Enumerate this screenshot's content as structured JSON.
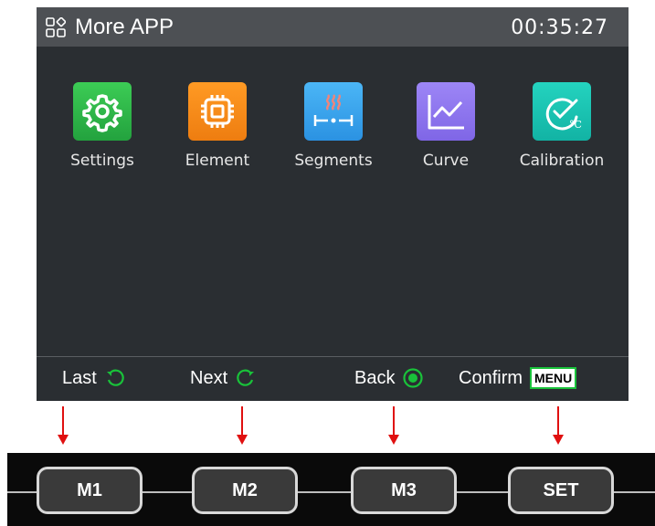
{
  "window": {
    "title": "More APP",
    "clock": "00:35:27"
  },
  "apps": [
    {
      "label": "Settings",
      "icon": "gear-icon",
      "color": "#2fb24a"
    },
    {
      "label": "Element",
      "icon": "chip-icon",
      "color": "#f08a1a"
    },
    {
      "label": "Segments",
      "icon": "heating-segments-icon",
      "color": "#3aa6ee"
    },
    {
      "label": "Curve",
      "icon": "line-chart-icon",
      "color": "#8f77ef"
    },
    {
      "label": "Calibration",
      "icon": "temperature-gauge-icon",
      "color": "#18c3b2"
    }
  ],
  "hints": {
    "last": "Last",
    "next": "Next",
    "back": "Back",
    "confirm": "Confirm",
    "menu_badge": "MENU"
  },
  "keys": {
    "m1": "M1",
    "m2": "M2",
    "m3": "M3",
    "set": "SET"
  },
  "colors": {
    "screen_bg": "#2a2e32",
    "titlebar_bg": "#4d5054",
    "accent_green": "#19c23a",
    "arrow_red": "#e01010"
  }
}
